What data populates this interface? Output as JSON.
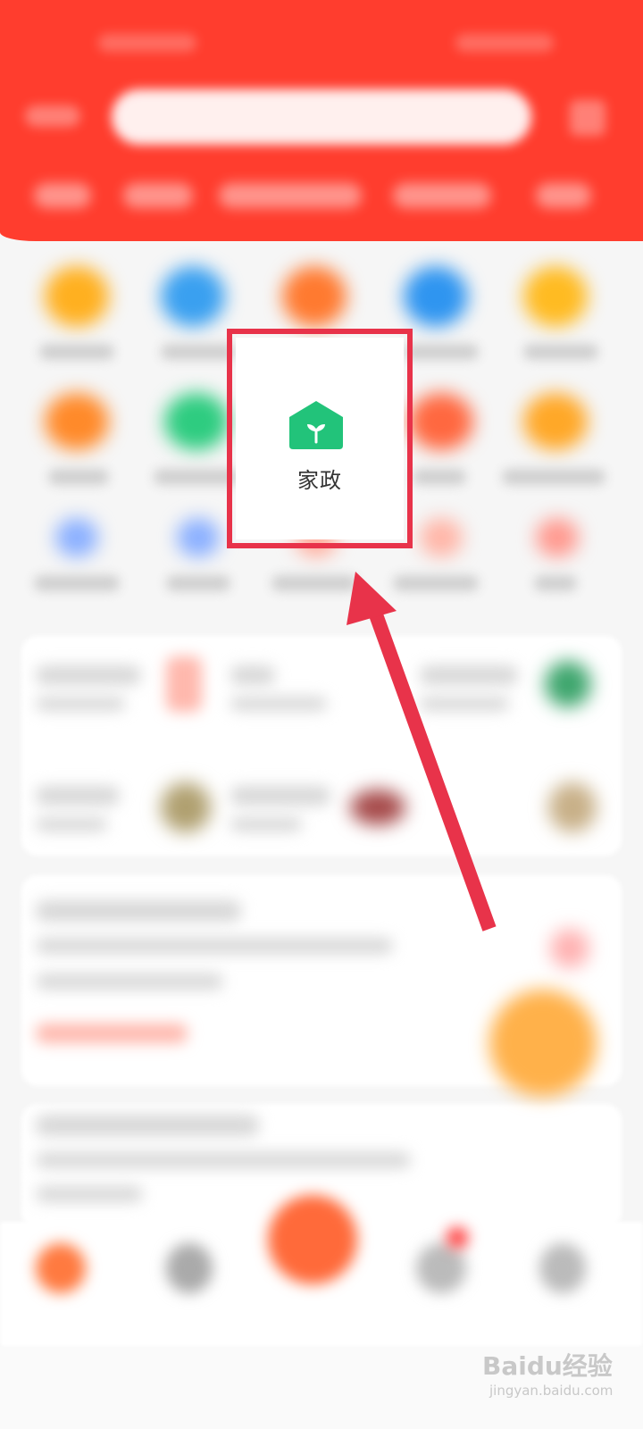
{
  "focused_item": {
    "label": "家政",
    "icon": "house-sprout-icon",
    "icon_color": "#22c37a",
    "highlight_color": "#e8334a"
  },
  "theme": {
    "header_color": "#ff3d2e",
    "annotation_color": "#e8334a"
  },
  "watermark": {
    "logo_text": "Baidu经验",
    "url": "jingyan.baidu.com"
  }
}
